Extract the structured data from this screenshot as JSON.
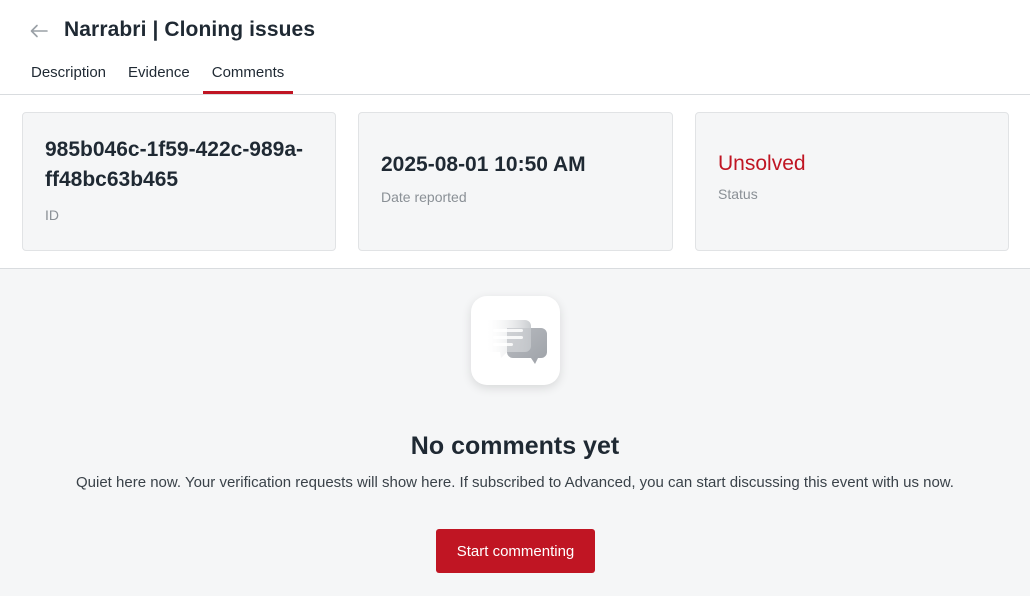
{
  "header": {
    "title": "Narrabri | Cloning issues",
    "tabs": [
      {
        "label": "Description",
        "active": false
      },
      {
        "label": "Evidence",
        "active": false
      },
      {
        "label": "Comments",
        "active": true
      }
    ]
  },
  "summary": {
    "id": {
      "value": "985b046c-1f59-422c-989a-ff48bc63b465",
      "label": "ID"
    },
    "date": {
      "value": "2025-08-01 10:50 AM",
      "label": "Date reported"
    },
    "status": {
      "value": "Unsolved",
      "label": "Status"
    }
  },
  "comments": {
    "empty_title": "No comments yet",
    "empty_description": "Quiet here now. Your verification requests will show here. If subscribed to Advanced, you can start discussing this event with us now.",
    "cta_label": "Start commenting"
  },
  "colors": {
    "accent": "#c01523",
    "panel": "#f5f6f7"
  },
  "icons": {
    "back": "arrow-left-icon",
    "empty": "chat-bubbles-icon"
  }
}
